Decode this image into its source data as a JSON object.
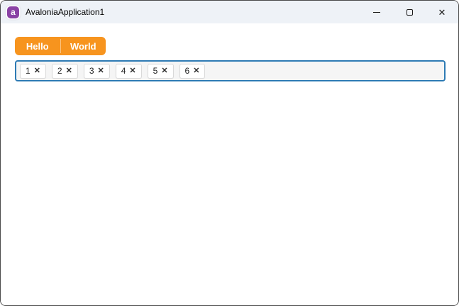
{
  "window": {
    "title": "AvaloniaApplication1",
    "app_icon": "avalonia-logo",
    "app_icon_letter": "a",
    "controls": {
      "minimize_icon": "window-minimize",
      "maximize_icon": "window-maximize",
      "close_icon": "window-close",
      "close_glyph": "✕"
    }
  },
  "tabstrip": {
    "items": [
      {
        "label": "Hello"
      },
      {
        "label": "World"
      }
    ]
  },
  "tagsbox": {
    "remove_glyph": "✕",
    "chips": [
      {
        "value": "1"
      },
      {
        "value": "2"
      },
      {
        "value": "3"
      },
      {
        "value": "4"
      },
      {
        "value": "5"
      },
      {
        "value": "6"
      }
    ]
  },
  "colors": {
    "accent_orange": "#F7941E",
    "tagsbox_border_blue": "#2E7BB4",
    "titlebar_bg": "#EEF2F7",
    "container_bg": "#F5F5F5",
    "chip_border": "#D9D9D9",
    "logo_purple": "#8A42A5",
    "window_border": "#4A4A4A"
  }
}
